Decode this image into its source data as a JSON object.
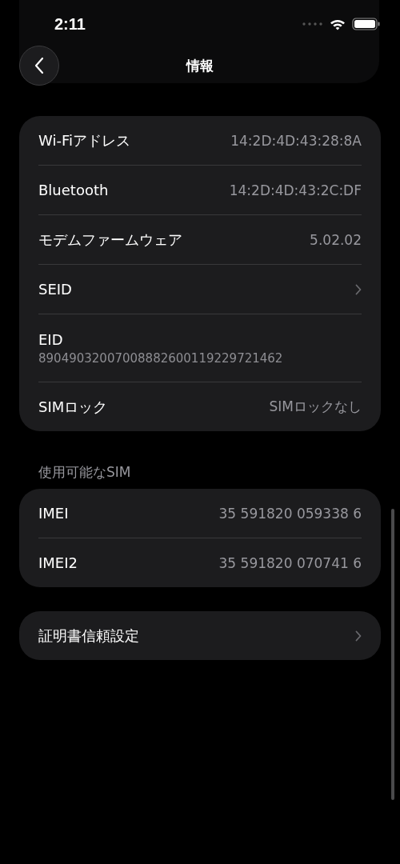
{
  "status_bar": {
    "time": "2:11"
  },
  "nav": {
    "title": "情報"
  },
  "groups": [
    {
      "rows": [
        {
          "kind": "value",
          "label": "Wi-Fiアドレス",
          "value": "14:2D:4D:43:28:8A"
        },
        {
          "kind": "value",
          "label": "Bluetooth",
          "value": "14:2D:4D:43:2C:DF"
        },
        {
          "kind": "value",
          "label": "モデムファームウェア",
          "value": "5.02.02"
        },
        {
          "kind": "link",
          "label": "SEID"
        },
        {
          "kind": "stacked",
          "label": "EID",
          "value": "89049032007008882600119229721462"
        },
        {
          "kind": "value",
          "label": "SIMロック",
          "value": "SIMロックなし"
        }
      ]
    },
    {
      "header": "使用可能なSIM",
      "rows": [
        {
          "kind": "value",
          "label": "IMEI",
          "value": "35 591820 059338 6"
        },
        {
          "kind": "value",
          "label": "IMEI2",
          "value": "35 591820 070741 6"
        }
      ]
    },
    {
      "rows": [
        {
          "kind": "link",
          "label": "証明書信頼設定"
        }
      ]
    }
  ]
}
